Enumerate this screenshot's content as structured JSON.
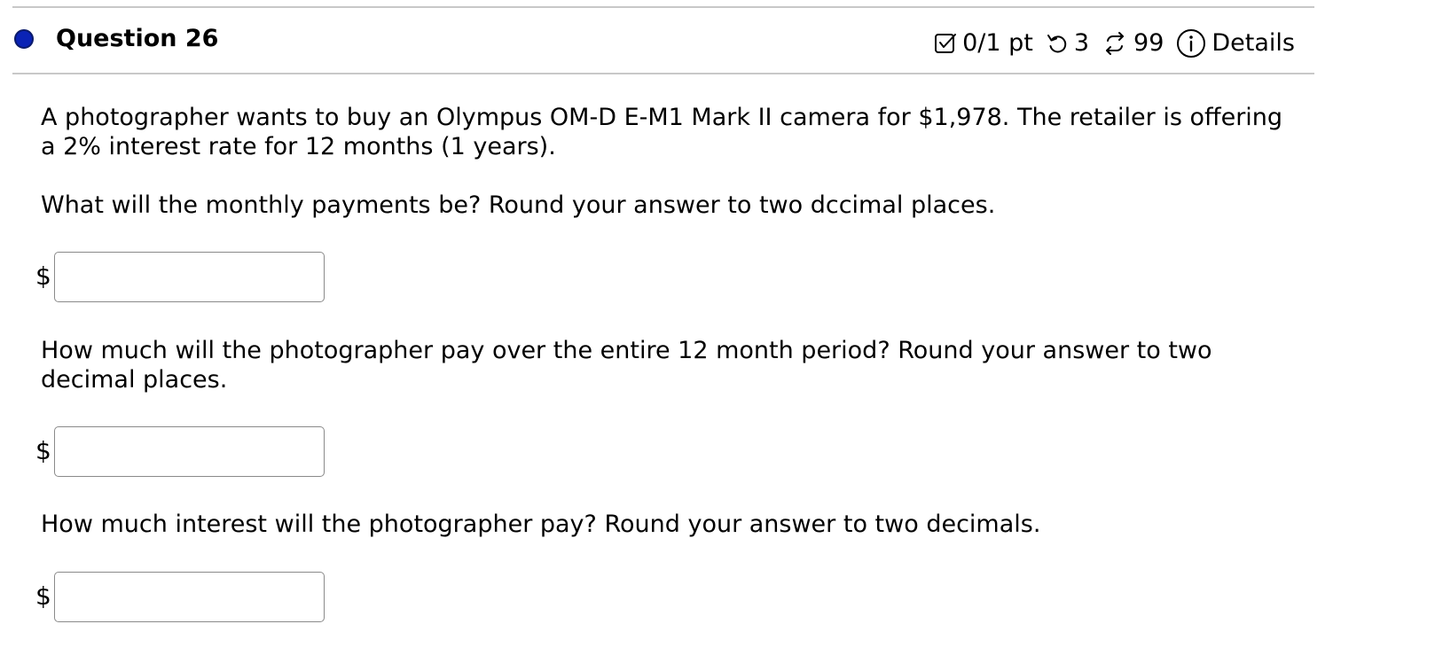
{
  "question": {
    "title": "Question 26",
    "score": "0/1 pt",
    "retries": "3",
    "attempts": "99",
    "details_label": "Details"
  },
  "icons": {
    "status": "status-dot-icon",
    "score": "checkbox-icon",
    "retries": "retry-icon",
    "attempts": "repeat-arrows-icon",
    "details": "info-icon"
  },
  "colors": {
    "status_dot": "#0a23b5"
  },
  "problem": {
    "text": "A photographer wants to buy an Olympus OM-D E-M1 Mark II camera for $1,978. The retailer is offering a 2% interest rate for 12 months (1 years).",
    "parts": [
      {
        "prompt": "What will the monthly payments be? Round your answer to two dccimal places.",
        "currency": "$",
        "value": ""
      },
      {
        "prompt": "How much will the photographer pay over the entire 12 month period? Round your answer to two decimal places.",
        "currency": "$",
        "value": ""
      },
      {
        "prompt": "How much interest will the photographer pay? Round your answer to two decimals.",
        "currency": "$",
        "value": ""
      }
    ]
  }
}
